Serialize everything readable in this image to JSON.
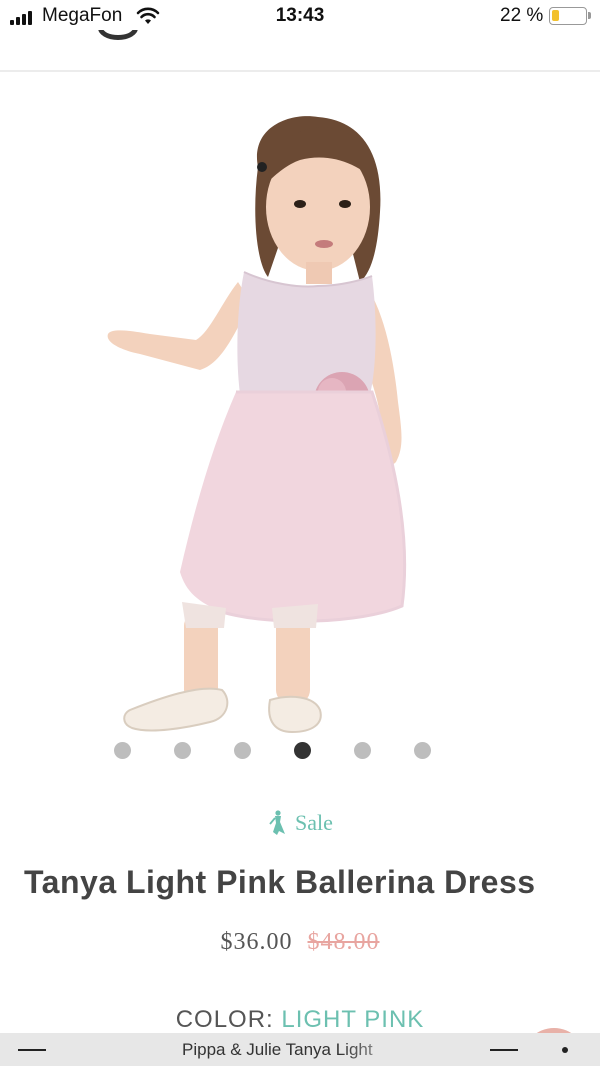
{
  "status_bar": {
    "carrier": "MegaFon",
    "time": "13:43",
    "battery_percent": "22 %",
    "battery_level": 0.22,
    "battery_color": "#f2c12e"
  },
  "product": {
    "image_alt": "Girl wearing light pink ballerina dress",
    "carousel_active_index": 3,
    "carousel_count": 6,
    "sale_icon": "sale-figure-icon",
    "sale_label": "Sale",
    "title": "Tanya Light Pink Ballerina Dress",
    "price_sale": "$36.00",
    "price_original": "$48.00",
    "color_label": "COLOR:",
    "color_value": "LIGHT PINK"
  },
  "bottom_bar": {
    "page_title": "Pippa & Julie Tanya Light"
  },
  "colors": {
    "accent": "#6cc0b0",
    "strike_price": "#e8a5a0",
    "title": "#444444"
  }
}
